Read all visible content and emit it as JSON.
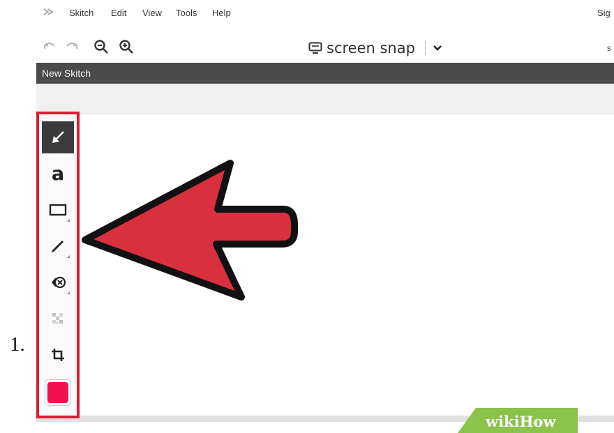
{
  "step": {
    "number": "1."
  },
  "app": {
    "menu": [
      "Skitch",
      "Edit",
      "View",
      "Tools",
      "Help"
    ],
    "signin_partial": "Sig"
  },
  "toolbar": {
    "undo_icon": "undo-icon",
    "redo_icon": "redo-icon",
    "zoom_out_icon": "zoom-out-icon",
    "zoom_in_icon": "zoom-in-icon",
    "screen_snap_label": "screen snap",
    "right_partial": "s"
  },
  "document": {
    "title": "New Skitch"
  },
  "tools": [
    {
      "name": "arrow",
      "icon": "arrow-tool-icon",
      "selected": true
    },
    {
      "name": "text",
      "icon": "text-tool-icon",
      "glyph": "a"
    },
    {
      "name": "rectangle",
      "icon": "rectangle-tool-icon"
    },
    {
      "name": "pen",
      "icon": "pen-tool-icon"
    },
    {
      "name": "stamp",
      "icon": "stamp-tool-icon"
    },
    {
      "name": "pixelate",
      "icon": "pixelate-tool-icon"
    },
    {
      "name": "crop",
      "icon": "crop-tool-icon"
    }
  ],
  "color": {
    "current": "#f0134f",
    "highlight": "#d81e35",
    "arrow_fill": "#d8303e"
  },
  "watermark": {
    "prefix": "wiki",
    "suffix": "How",
    "color": "#8bc34a"
  }
}
